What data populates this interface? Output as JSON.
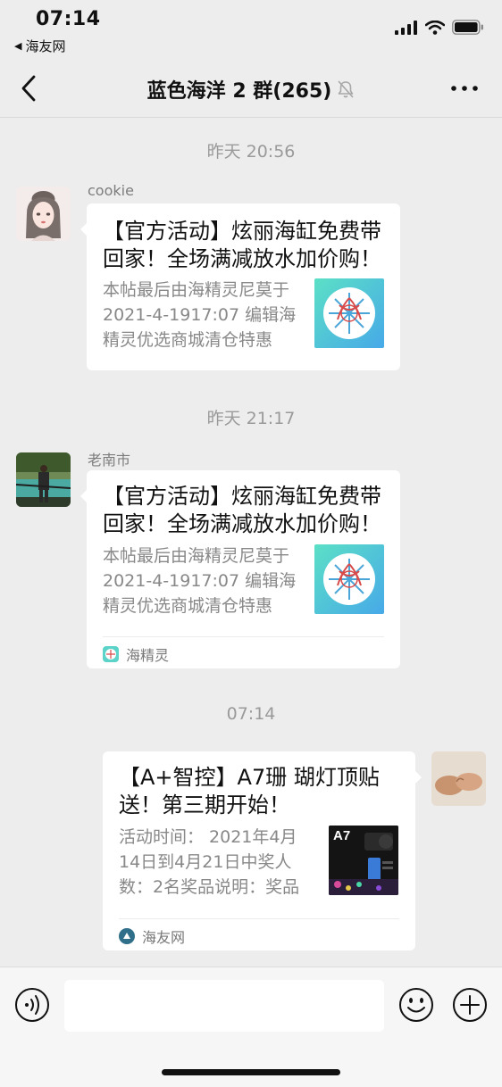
{
  "status_bar": {
    "time": "07:14",
    "back_app": "海友网"
  },
  "nav": {
    "title": "蓝色海洋 2 群(265)",
    "icons": [
      "back-chevron-icon",
      "mute-bell-icon",
      "more-icon"
    ]
  },
  "messages": [
    {
      "timestamp": "昨天 20:56",
      "sender": "cookie",
      "title": "【官方活动】炫丽海缸免费带回家！全场满减放水加价购！",
      "desc": "本帖最后由海精灵尼莫于 2021-4-1917:07 编辑海精灵优选商城清仓特惠",
      "source": ""
    },
    {
      "timestamp": "昨天 21:17",
      "sender": "老南市",
      "title": "【官方活动】炫丽海缸免费带回家！全场满减放水加价购！",
      "desc": "本帖最后由海精灵尼莫于 2021-4-1917:07 编辑海精灵优选商城清仓特惠",
      "source": "海精灵"
    },
    {
      "timestamp": "07:14",
      "sender": "",
      "title": "【A+智控】A7珊 瑚灯顶贴送！第三期开始！",
      "desc": "活动时间： 2021年4月14日到4月21日中奖人数：2名奖品说明：奖品",
      "source": "海友网",
      "thumb_label": "A7"
    }
  ],
  "input_bar": {
    "placeholder": "",
    "icons": [
      "voice-icon",
      "emoji-icon",
      "plus-icon"
    ]
  }
}
